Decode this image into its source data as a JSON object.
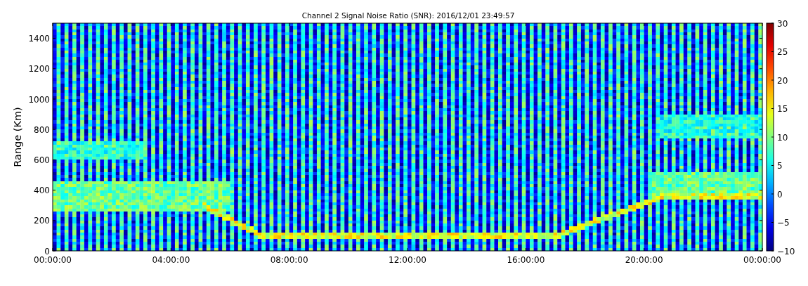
{
  "figure": {
    "title": "Channel 2 Signal Noise Ratio (SNR): 2016/12/01 23:49:57",
    "y_axis": {
      "label": "Range (Km)",
      "ticks": [
        "1400",
        "1200",
        "1000",
        "800",
        "600",
        "400",
        "200",
        "0"
      ]
    },
    "x_axis": {
      "ticks": [
        "00:00:00",
        "04:00:00",
        "08:00:00",
        "12:00:00",
        "16:00:00",
        "20:00:00",
        "00:00:00"
      ]
    },
    "colorbar": {
      "ticks": [
        "30",
        "25",
        "20",
        "15",
        "10",
        "5",
        "0",
        "−5",
        "−10"
      ]
    }
  }
}
